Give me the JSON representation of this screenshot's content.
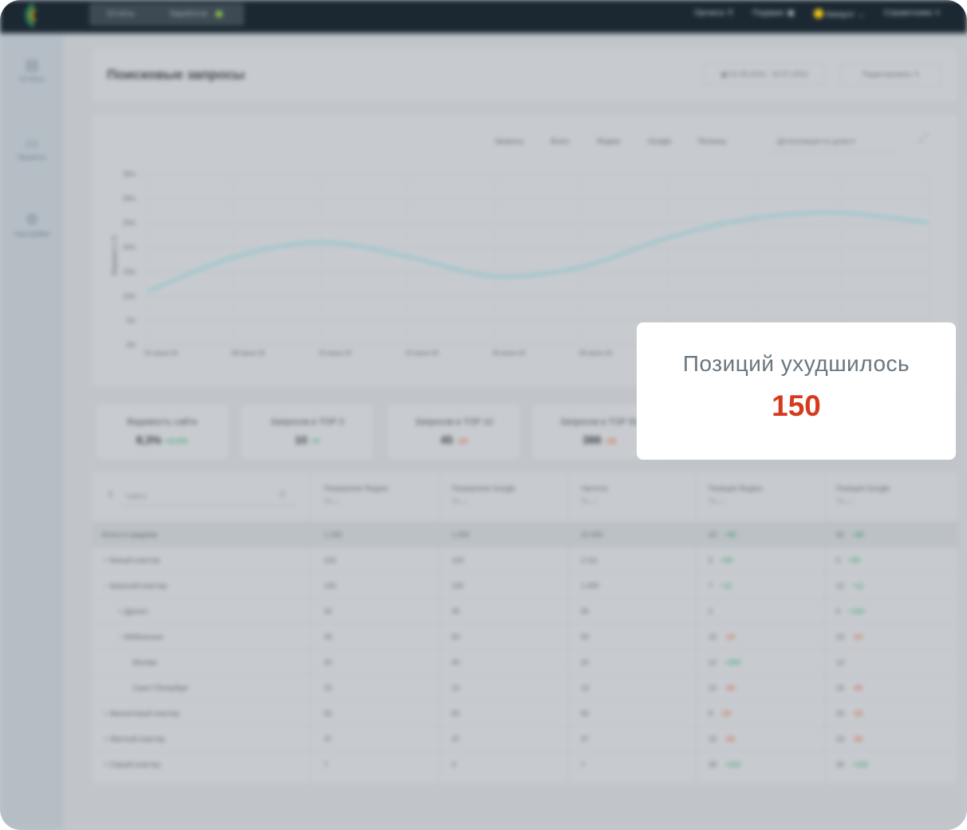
{
  "topbar": {
    "tabs": [
      "Отчеты",
      "Заработок"
    ],
    "links": [
      {
        "label": "Оргкиса",
        "icon": "search-icon"
      },
      {
        "label": "Подарки",
        "icon": "gift-icon"
      },
      {
        "label": "Аккаунт",
        "icon": "chevron-icon"
      },
      {
        "label": "Справочники",
        "icon": "menu-icon"
      }
    ]
  },
  "sidebar": {
    "items": [
      {
        "label": "Отчёты",
        "icon": "report-icon"
      },
      {
        "label": "Проекты",
        "icon": "folder-icon"
      },
      {
        "label": "Настройки",
        "icon": "settings-icon"
      }
    ]
  },
  "header": {
    "title": "Поисковые запросы",
    "date_range": "01.05.2024 - 15.07.2024",
    "edit_button": "Редактировать"
  },
  "chart": {
    "filters": [
      "Запросы",
      "Всего",
      "Яндекс",
      "Google",
      "Регионы"
    ],
    "dropdown": "Детализация по дням",
    "y_ticks": [
      "0%",
      "5%",
      "10%",
      "15%",
      "20%",
      "25%",
      "30%",
      "35%"
    ],
    "x_ticks": [
      "01 июня 24",
      "08 июня 24",
      "15 июня 24",
      "22 июня 24",
      "29 июня 24",
      "06 июля 24"
    ],
    "ylabel": "Видимость %"
  },
  "chart_data": {
    "type": "line",
    "x": [
      "01 июня 24",
      "08 июня 24",
      "15 июня 24",
      "22 июня 24",
      "29 июня 24",
      "06 июля 24",
      "13 июля 24",
      "20 июля 24",
      "27 июля 24",
      "03 авг 24"
    ],
    "series": [
      {
        "values": [
          11,
          18,
          21,
          18,
          14,
          16,
          22,
          26,
          27,
          25
        ]
      }
    ],
    "ylim": [
      0,
      35
    ],
    "grid": true
  },
  "kpis": [
    {
      "label": "Видимость сайта",
      "value": "8,3%",
      "change": "+0,6%",
      "sign": "pos"
    },
    {
      "label": "Запросов в TOP 3",
      "value": "10",
      "change": "+4",
      "sign": "pos"
    },
    {
      "label": "Запросов в TOP 10",
      "value": "45",
      "change": "-10",
      "sign": "neg"
    },
    {
      "label": "Запросов в TOP 50",
      "value": "388",
      "change": "-18",
      "sign": "neg"
    }
  ],
  "table": {
    "search_placeholder": "Найти",
    "columns": [
      {
        "title": "Показатели Яндекс",
        "sub": "Тз  ↓↑"
      },
      {
        "title": "Показатели Google",
        "sub": "Тз  ↓↑"
      },
      {
        "title": "Частота",
        "sub": "Тз  ↓↑"
      },
      {
        "title": "Позиция Яндекс",
        "sub": "Тз  ↓↑"
      },
      {
        "title": "Позиция Google",
        "sub": "Тз  ↓↑"
      }
    ],
    "rows": [
      {
        "name": "Итого в среднем",
        "c": [
          "1 200",
          "1 200",
          "10 000",
          "23",
          "30"
        ],
        "d4": "+80",
        "d4s": "pos",
        "d5": "+80",
        "d5s": "pos",
        "indent": 0
      },
      {
        "name": "Белый кластер",
        "c": [
          "103",
          "103",
          "2 111",
          "5",
          "5"
        ],
        "d4": "+60",
        "d4s": "pos",
        "d5": "+90",
        "d5s": "pos",
        "indent": 0
      },
      {
        "name": "Красный кластер",
        "c": [
          "105",
          "100",
          "1 400",
          "7",
          "12"
        ],
        "d4": "+11",
        "d4s": "pos",
        "d5": "+11",
        "d5s": "pos",
        "indent": 0
      },
      {
        "name": "Дронго",
        "c": [
          "34",
          "45",
          "55",
          "2",
          "5"
        ],
        "d4": "",
        "d4s": "pos",
        "d5": "+100",
        "d5s": "pos",
        "indent": 1
      },
      {
        "name": "Мебельные",
        "c": [
          "45",
          "50",
          "50",
          "15",
          "24"
        ],
        "d4": "-10",
        "d4s": "neg",
        "d5": "-10",
        "d5s": "neg",
        "indent": 1
      },
      {
        "name": "Москва",
        "c": [
          "20",
          "40",
          "20",
          "12",
          "12"
        ],
        "d4": "+200",
        "d4s": "pos",
        "d5": "",
        "d5s": "pos",
        "indent": 2
      },
      {
        "name": "Санкт-Петербург",
        "c": [
          "15",
          "10",
          "13",
          "10",
          "16"
        ],
        "d4": "-40",
        "d4s": "neg",
        "d5": "-40",
        "d5s": "neg",
        "indent": 2
      },
      {
        "name": "Фиолетовый кластер",
        "c": [
          "50",
          "55",
          "50",
          "8",
          "20"
        ],
        "d4": "-20",
        "d4s": "neg",
        "d5": "-20",
        "d5s": "neg",
        "indent": 0
      },
      {
        "name": "Желтый кластер",
        "c": [
          "37",
          "37",
          "37",
          "15",
          "23"
        ],
        "d4": "-40",
        "d4s": "neg",
        "d5": "-40",
        "d5s": "neg",
        "indent": 0
      },
      {
        "name": "Серый кластер",
        "c": [
          "7",
          "3",
          "7",
          "28",
          "34"
        ],
        "d4": "+100",
        "d4s": "pos",
        "d5": "+100",
        "d5s": "pos",
        "indent": 0
      }
    ]
  },
  "popup": {
    "title": "Позиций ухудшилось",
    "value": "150",
    "value_color": "#d63a1d"
  }
}
